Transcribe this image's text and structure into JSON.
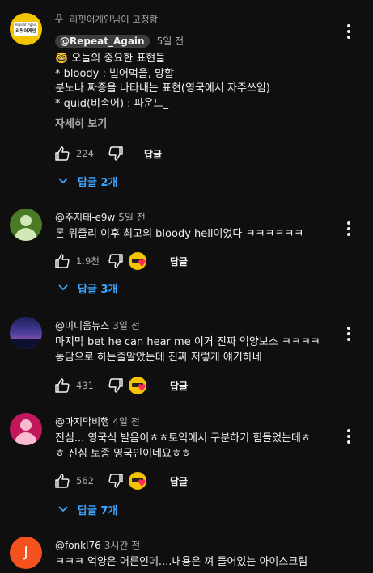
{
  "pinned": {
    "pinned_label": "리핏어게인님이 고정함",
    "author": "@Repeat_Again",
    "time": "5일 전",
    "avatar_text_top": "Repeat Again",
    "avatar_text_main": "리핏어게인",
    "lines": [
      "🤓 오늘의 중요한 표현들",
      "* bloody : 빌어먹을, 망할",
      "분노나 짜증을 나타내는 표현(영국에서 자주쓰임)",
      "* quid(비속어) : 파운드_"
    ],
    "read_more": "자세히 보기",
    "likes": "224",
    "reply_label": "답글",
    "replies_toggle": "답글 2개"
  },
  "comments": [
    {
      "author": "@주지태-e9w",
      "time": "5일 전",
      "lines": [
        "론 위즐리 이후 최고의 bloody hell이었다 ㅋㅋㅋㅋㅋㅋ"
      ],
      "likes": "1.9천",
      "reply_label": "답글",
      "replies_toggle": "답글 3개",
      "avatar_color": "#5a8a2e"
    },
    {
      "author": "@미디움뉴스",
      "time": "3일 전",
      "lines": [
        "마지막 bet he can hear me 이거 진짜 억양보소 ㅋㅋㅋㅋ",
        "농담으로 하는줄알았는데 진짜 저렇게 얘기하네"
      ],
      "likes": "431",
      "reply_label": "답글",
      "avatar_color": "#3b3f8a"
    },
    {
      "author": "@마지막비행",
      "time": "4일 전",
      "lines": [
        "진심... 영국식 발음이ㅎㅎ토익에서 구분하기 힘들었는데ㅎ",
        "ㅎ 진심 토종 영국인이네요ㅎㅎ"
      ],
      "likes": "562",
      "reply_label": "답글",
      "replies_toggle": "답글 7개",
      "avatar_color": "#c2185b"
    },
    {
      "author": "@fonkl76",
      "time": "3시간 전",
      "lines": [
        "ㅋㅋㅋ 억양은 어른인데....내용은 껴 들어있는 아이스크림"
      ],
      "avatar_letter": "J",
      "avatar_color": "#f4511e"
    }
  ]
}
